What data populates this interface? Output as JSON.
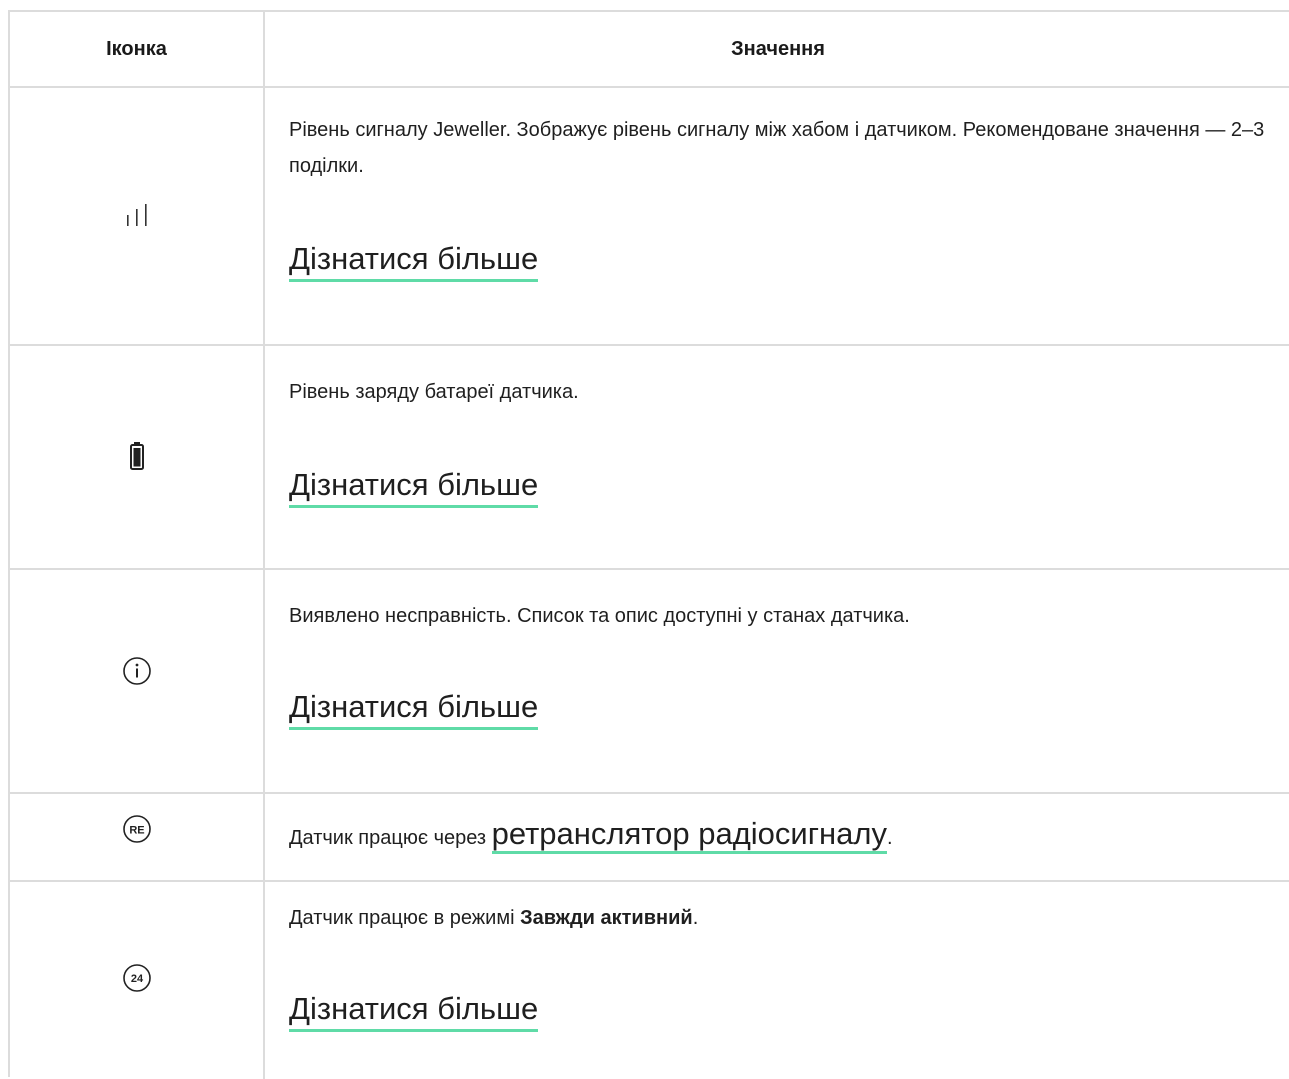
{
  "header": {
    "col_icon": "Іконка",
    "col_meaning": "Значення"
  },
  "rows": [
    {
      "icon": "signal-strength-icon",
      "text": "Рівень сигналу Jeweller. Зображує рівень сигналу між хабом і датчиком. Рекомендоване значення — 2–3 поділки.",
      "link": "Дізнатися більше"
    },
    {
      "icon": "battery-icon",
      "text": "Рівень заряду батареї датчика.",
      "link": "Дізнатися більше"
    },
    {
      "icon": "info-icon",
      "text": "Виявлено несправність. Список та опис доступні у станах датчика.",
      "link": "Дізнатися більше"
    },
    {
      "icon": "range-extender-icon",
      "icon_text": "RE",
      "text_before": "Датчик працює через ",
      "link": "ретранслятор радіосигналу",
      "text_after": "."
    },
    {
      "icon": "always-active-icon",
      "icon_text": "24",
      "text_before": "Датчик працює в режимі ",
      "text_bold": "Завжди активний",
      "text_after": ".",
      "link": "Дізнатися більше"
    }
  ],
  "colors": {
    "border": "#dcdcdc",
    "link_underline": "#5fdba7",
    "text": "#1f1f1f"
  }
}
